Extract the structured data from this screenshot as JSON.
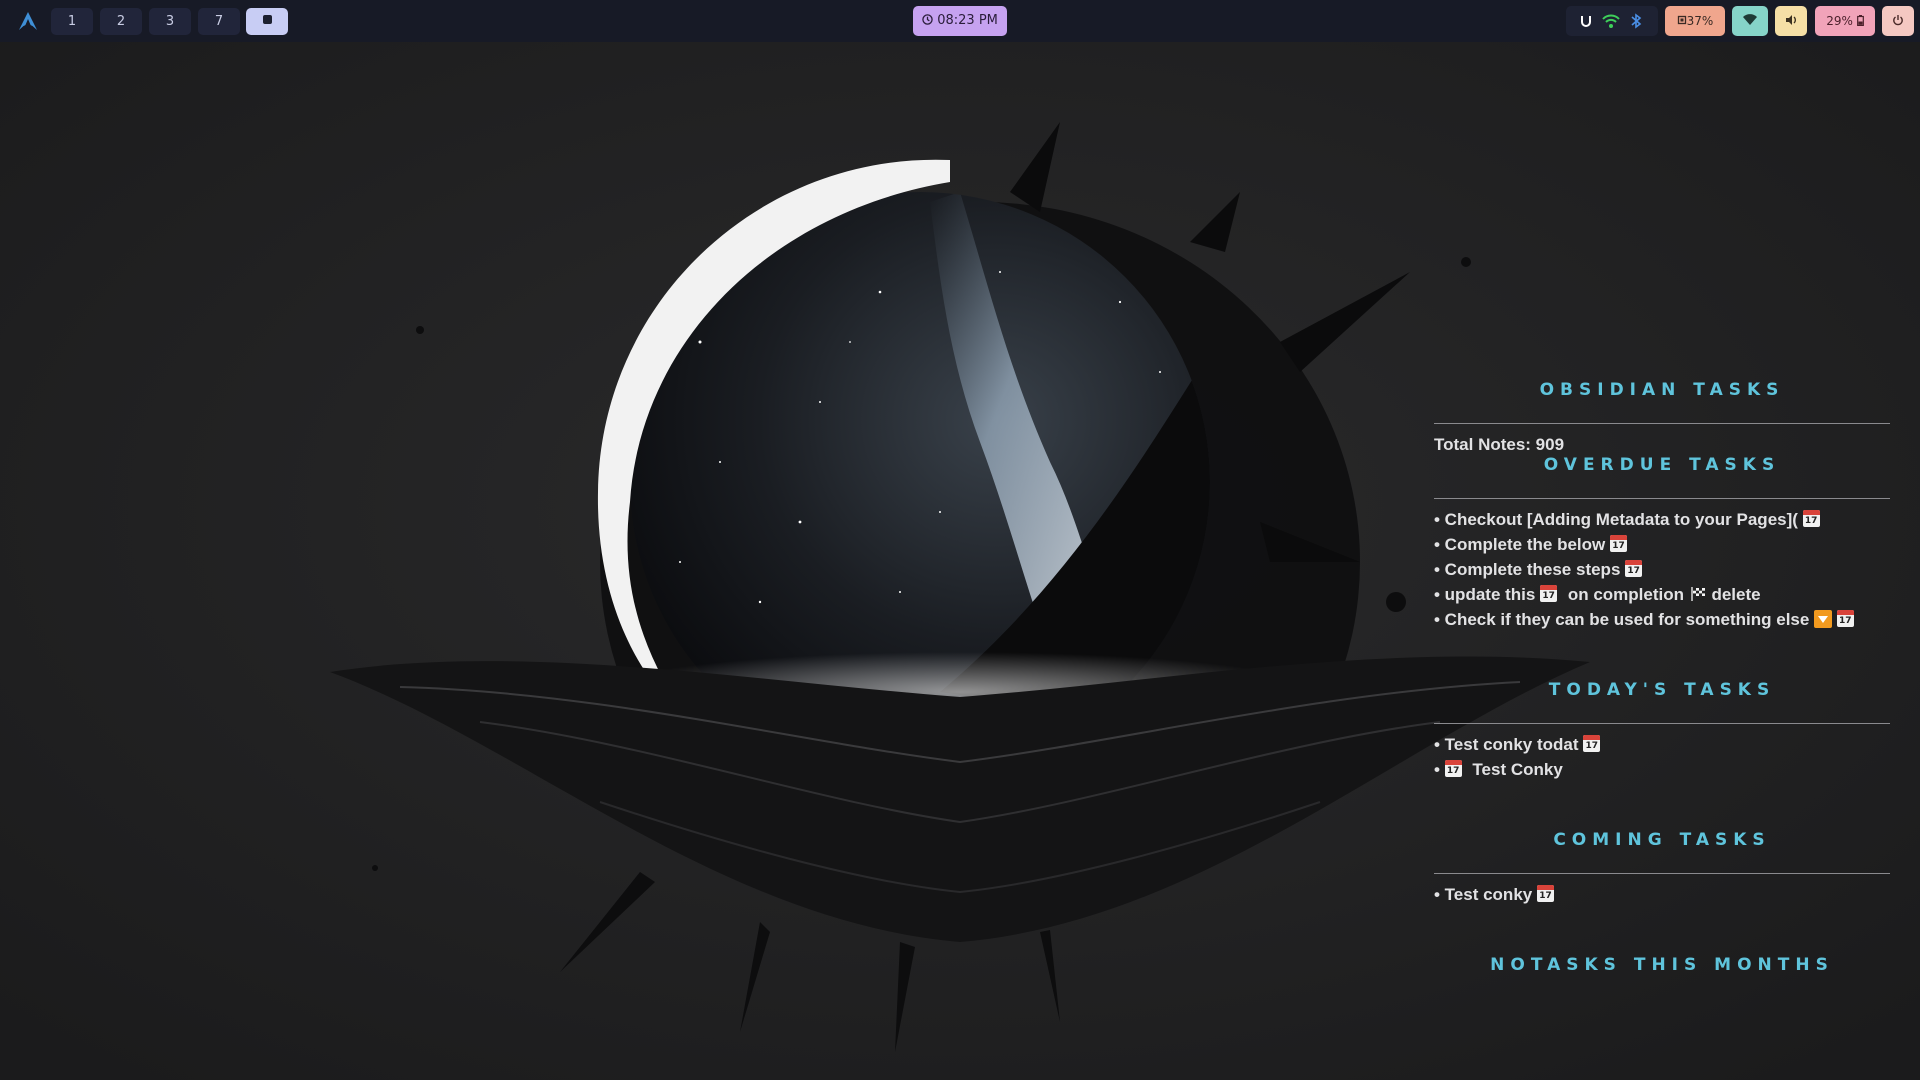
{
  "workspaces": [
    "1",
    "2",
    "3",
    "7"
  ],
  "clock": "08:23 PM",
  "status": {
    "cpu": "37%",
    "battery": "29%"
  },
  "colors": {
    "clock": "#c6a2f0",
    "cpu": "#f0a68d",
    "wifi": "#86d4c9",
    "volume": "#f5dfa6",
    "battery": "#f1a3b9",
    "power": "#f4c8c2",
    "section_title": "#5fc4dc"
  },
  "icons": {
    "launcher": "arch-logo-icon",
    "clock": "clock-icon",
    "tray": [
      "headset-icon",
      "wifi-icon",
      "bluetooth-icon"
    ],
    "cpu": "cpu-icon",
    "wifi_pill": "wifi-icon",
    "volume": "speaker-icon",
    "battery": "battery-icon",
    "power": "power-icon"
  },
  "conky": {
    "title": "OBSIDIAN TASKS",
    "total_notes": "Total Notes: 909",
    "overdue": {
      "title": "OVERDUE TASKS",
      "items": [
        "• Checkout  [Adding Metadata to your Pages](",
        "• Complete the below",
        "• Complete these steps",
        "• update this",
        "on completion",
        "delete",
        "• Check if they can be used for something else"
      ]
    },
    "today": {
      "title": "TODAY'S TASKS",
      "items": [
        "• Test conky todat",
        "•",
        "Test Conky"
      ]
    },
    "coming": {
      "title": "COMING TASKS",
      "items": [
        "• Test conky"
      ]
    },
    "footer": "NOTASKS  THIS  MONTHS"
  }
}
